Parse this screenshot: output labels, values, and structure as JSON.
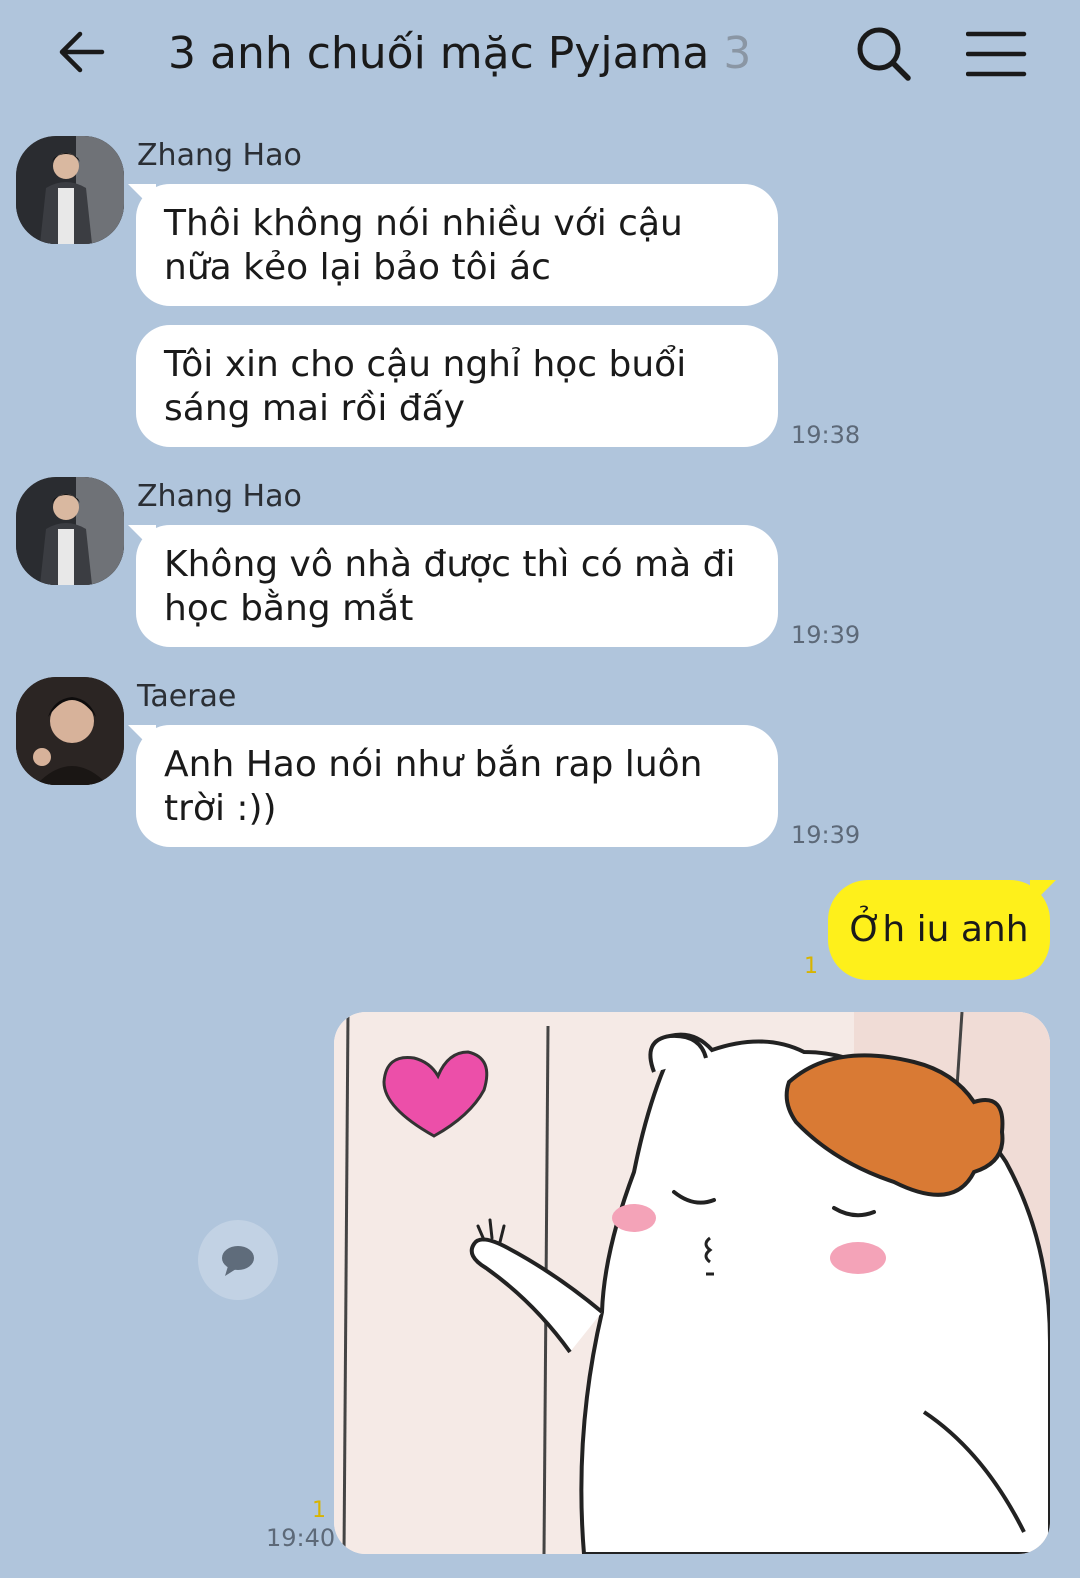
{
  "header": {
    "title": "3 anh chuối mặc Pyjama",
    "member_count": "3"
  },
  "messages": [
    {
      "sender": "Zhang Hao",
      "bubbles": [
        "Thôi không nói nhiều với cậu nữa kẻo lại bảo tôi ác",
        "Tôi xin cho cậu nghỉ học buổi sáng mai rồi đấy"
      ],
      "time": "19:38"
    },
    {
      "sender": "Zhang Hao",
      "bubbles": [
        "Không vô nhà được thì có mà đi học bằng mắt"
      ],
      "time": "19:39"
    },
    {
      "sender": "Taerae",
      "bubbles": [
        "Anh Hao nói như bắn rap luôn trời :))"
      ],
      "time": "19:39"
    }
  ],
  "my_messages": [
    {
      "text": "Ởh iu anh",
      "unread": "1"
    },
    {
      "type": "image",
      "image_description": "hamster-sticker-blowing-kiss",
      "unread": "1",
      "time": "19:40"
    }
  ],
  "colors": {
    "background": "#b0c5dc",
    "my_bubble": "#fef01b",
    "other_bubble": "#ffffff",
    "heart": "#ec4fa9",
    "hamster_hair": "#d97a34"
  }
}
